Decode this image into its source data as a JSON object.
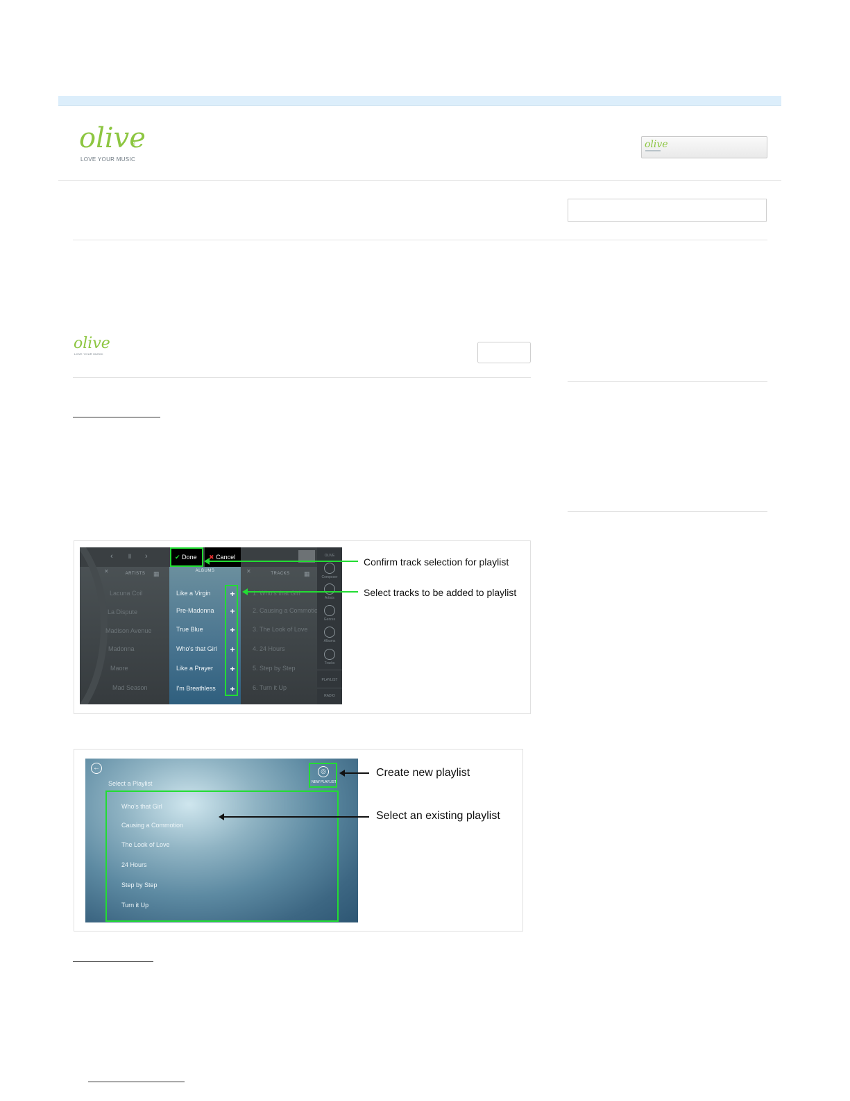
{
  "header": {
    "logo_word": "olive",
    "logo_registered": "®",
    "logo_tagline": "LOVE YOUR MUSIC"
  },
  "inner_header": {
    "logo_word": "olive",
    "logo_tagline": "LOVE YOUR MUSIC"
  },
  "screenshot1": {
    "done_label": "Done",
    "cancel_label": "Cancel",
    "col_artists": "ARTISTS",
    "col_albums": "ALBUMS",
    "col_tracks": "TRACKS",
    "artists": [
      "Lacuna Coil",
      "La Dispute",
      "Madison Avenue",
      "Madonna",
      "Maore",
      "Mad Season"
    ],
    "albums": [
      "Like a Virgin",
      "Pre-Madonna",
      "True Blue",
      "Who's that Girl",
      "Like a Prayer",
      "I'm Breathless"
    ],
    "tracks": [
      "1. Who's that Girl",
      "2. Causing a Commotion",
      "3. The Look of Love",
      "4. 24 Hours",
      "5. Step by Step",
      "6. Turn it Up"
    ],
    "sidebar": [
      "Composer",
      "Artists",
      "Genres",
      "Albums",
      "Tracks"
    ],
    "side_playlist": "PLAYLIST",
    "side_radio": "RADIO",
    "side_top": "OLIVE",
    "annotation_confirm": "Confirm track selection for playlist",
    "annotation_select": "Select tracks to be added to playlist"
  },
  "screenshot2": {
    "title": "Select a Playlist",
    "new_playlist_label": "NEW PLAYLIST",
    "playlists": [
      "Who's that Girl",
      "Causing a Commotion",
      "The Look of Love",
      "24 Hours",
      "Step by Step",
      "Turn it Up"
    ],
    "annotation_create": "Create new playlist",
    "annotation_select": "Select an existing playlist"
  },
  "colors": {
    "brand_green": "#8dc641",
    "highlight_green": "#22dd33",
    "topbar_blue": "#dceefb"
  },
  "icons": {
    "done": "checkmark-icon",
    "cancel": "x-icon",
    "add_track": "plus-icon",
    "back": "back-arrow-icon",
    "new_playlist": "compass-icon"
  }
}
